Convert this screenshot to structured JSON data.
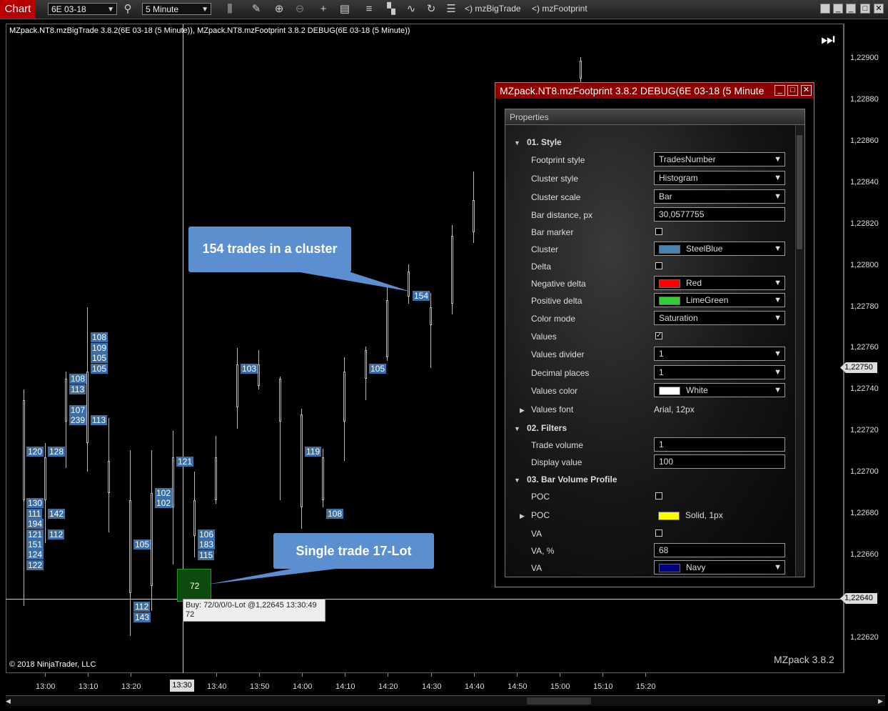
{
  "toolbar": {
    "tab_label": "Chart",
    "instrument": "6E 03-18",
    "timeframe": "5 Minute",
    "indicator1": "<) mzBigTrade",
    "indicator2": "<) mzFootprint",
    "icons": [
      "search-icon",
      "bar-style-icon",
      "draw-icon",
      "zoom-in-icon",
      "zoom-out-icon",
      "crosshair-icon",
      "data-box-icon",
      "order-bars-icon",
      "strategies-icon",
      "indicators-icon",
      "reload-icon",
      "properties-list-icon"
    ]
  },
  "chart": {
    "indicator_title": "MZpack.NT8.mzBigTrade 3.8.2(6E 03-18 (5 Minute)), MZpack.NT8.mzFootprint 3.8.2 DEBUG(6E 03-18 (5 Minute))",
    "copyright": "© 2018 NinjaTrader, LLC",
    "watermark": "MZpack 3.8.2",
    "price_labels": [
      "1,22900",
      "1,22880",
      "1,22860",
      "1,22840",
      "1,22820",
      "1,22800",
      "1,22780",
      "1,22760",
      "1,22740",
      "1,22720",
      "1,22700",
      "1,22680",
      "1,22660",
      "1,22620"
    ],
    "current_price": "1,22750",
    "crosshair_price": "1,22640",
    "time_labels": [
      "13:00",
      "13:10",
      "13:20",
      "13:40",
      "13:50",
      "14:00",
      "14:10",
      "14:20",
      "14:30",
      "14:40",
      "14:50",
      "15:00",
      "15:10",
      "15:20"
    ],
    "crosshair_time": "13:30",
    "cluster_values": [
      "108",
      "109",
      "105",
      "105",
      "108",
      "113",
      "107",
      "239",
      "113",
      "120",
      "128",
      "121",
      "102",
      "102",
      "103",
      "105",
      "119",
      "130",
      "111",
      "142",
      "194",
      "121",
      "112",
      "151",
      "124",
      "122",
      "105",
      "106",
      "183",
      "115",
      "112",
      "143",
      "108",
      "154"
    ],
    "big_trade_value": "72",
    "tooltip_line1": "Buy:  72/0/0/0-Lot  @1,22645  13:30:49",
    "tooltip_line2": "72",
    "callout1": "154 trades in a cluster",
    "callout2": "Single trade 17-Lot"
  },
  "properties_window": {
    "title": "MZpack.NT8.mzFootprint 3.8.2 DEBUG(6E 03-18 (5 Minute",
    "header": "Properties",
    "section1": "01. Style",
    "section2": "02. Filters",
    "section3": "03. Bar Volume Profile",
    "rows": {
      "footprint_style": {
        "label": "Footprint style",
        "value": "TradesNumber"
      },
      "cluster_style": {
        "label": "Cluster style",
        "value": "Histogram"
      },
      "cluster_scale": {
        "label": "Cluster scale",
        "value": "Bar"
      },
      "bar_distance": {
        "label": "Bar distance, px",
        "value": "30,0577755"
      },
      "bar_marker": {
        "label": "Bar marker"
      },
      "cluster": {
        "label": "Cluster",
        "value": "SteelBlue",
        "color": "#4682b4"
      },
      "delta": {
        "label": "Delta"
      },
      "negative_delta": {
        "label": "Negative delta",
        "value": "Red",
        "color": "#ff0000"
      },
      "positive_delta": {
        "label": "Positive delta",
        "value": "LimeGreen",
        "color": "#32cd32"
      },
      "color_mode": {
        "label": "Color mode",
        "value": "Saturation"
      },
      "values": {
        "label": "Values",
        "checked": "✓"
      },
      "values_divider": {
        "label": "Values divider",
        "value": "1"
      },
      "decimal_places": {
        "label": "Decimal places",
        "value": "1"
      },
      "values_color": {
        "label": "Values color",
        "value": "White",
        "color": "#ffffff"
      },
      "values_font": {
        "label": "Values font",
        "value": "Arial, 12px"
      },
      "trade_volume": {
        "label": "Trade volume",
        "value": "1"
      },
      "display_value": {
        "label": "Display value",
        "value": "100"
      },
      "poc_check": {
        "label": "POC"
      },
      "poc_style": {
        "label": "POC",
        "value": "Solid, 1px",
        "color": "#ffff00"
      },
      "va_check": {
        "label": "VA"
      },
      "va_percent": {
        "label": "VA, %",
        "value": "68"
      },
      "va_color": {
        "label": "VA",
        "value": "Navy",
        "color": "#000080"
      }
    }
  }
}
